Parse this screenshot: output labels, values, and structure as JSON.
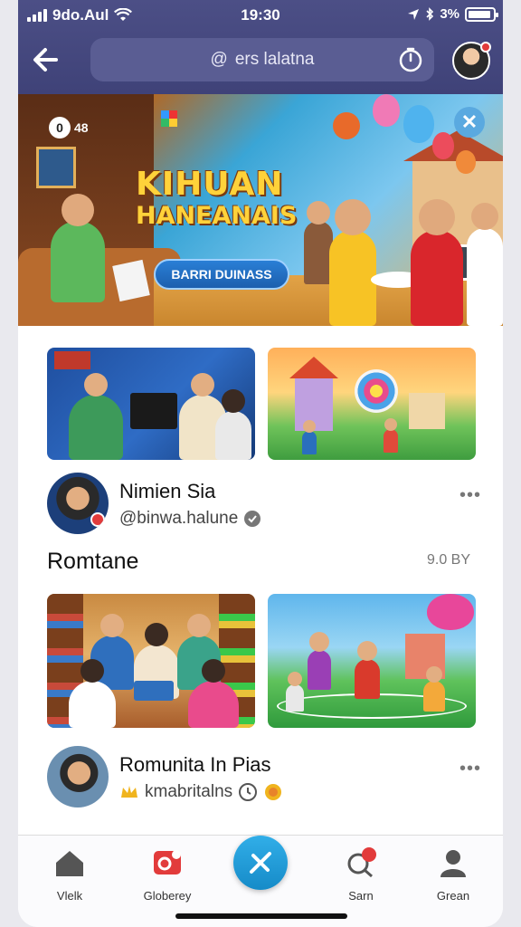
{
  "status_bar": {
    "carrier": "9do.Aul",
    "time": "19:30",
    "battery": "3%"
  },
  "header": {
    "search_text": "ers lalatna",
    "search_glyph": "@"
  },
  "hero": {
    "badge": "0",
    "badge_text": "48",
    "title_line1": "KIHUAN",
    "title_line2": "HANEANAIS",
    "cta": "BARRI DUINASS"
  },
  "post1": {
    "name": "Nimien Sia",
    "handle": "@binwa.halune",
    "more": "•••"
  },
  "section": {
    "title": "Romtane",
    "meta": "9.0 BY"
  },
  "post2": {
    "name": "Romunita In Pias",
    "handle": "kmabritalns",
    "more": "•••"
  },
  "nav": {
    "items": [
      {
        "label": "Vlelk",
        "icon": "home-icon"
      },
      {
        "label": "Globerey",
        "icon": "gallery-icon"
      },
      {
        "label": "",
        "icon": "compose-icon"
      },
      {
        "label": "Sarn",
        "icon": "search-badge-icon"
      },
      {
        "label": "Grean",
        "icon": "profile-icon"
      }
    ]
  },
  "colors": {
    "header": "#3f4278",
    "accent": "#168bc8",
    "badge_red": "#e23b3b"
  }
}
